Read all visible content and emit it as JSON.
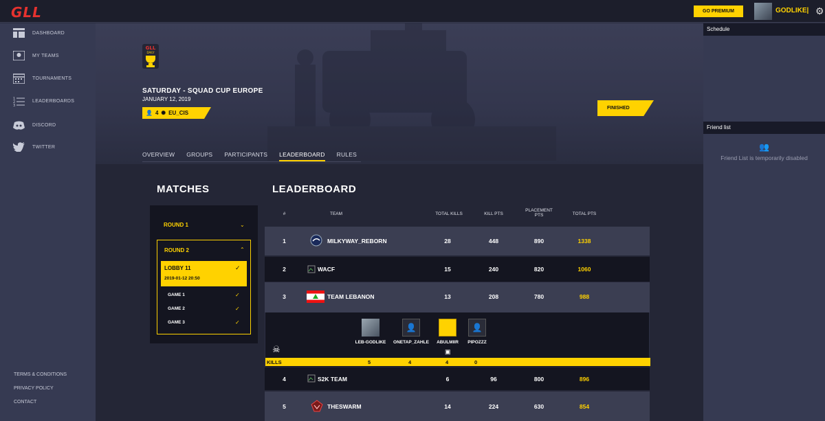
{
  "topbar": {
    "logo": "GLL",
    "premium_label": "GO PREMIUM",
    "username": "GODLIKE|"
  },
  "sidebar": {
    "items": [
      {
        "label": "DASHBOARD",
        "icon": "dashboard-icon"
      },
      {
        "label": "MY TEAMS",
        "icon": "teams-icon"
      },
      {
        "label": "TOURNAMENTS",
        "icon": "tournaments-icon"
      },
      {
        "label": "LEADERBOARDS",
        "icon": "leaderboards-icon"
      },
      {
        "label": "DISCORD",
        "icon": "discord-icon"
      },
      {
        "label": "TWITTER",
        "icon": "twitter-icon"
      }
    ],
    "footer": [
      "TERMS & CONDITIONS",
      "PRIVACY POLICY",
      "CONTACT"
    ]
  },
  "event": {
    "badge_top": "GLL",
    "badge_bottom": "DAILY",
    "title": "SATURDAY - SQUAD CUP EUROPE",
    "date": "JANUARY 12, 2019",
    "team_size": "4",
    "region": "EU_CIS",
    "status": "FINISHED"
  },
  "tabs": [
    "OVERVIEW",
    "GROUPS",
    "PARTICIPANTS",
    "LEADERBOARD",
    "RULES"
  ],
  "active_tab": "LEADERBOARD",
  "matches": {
    "heading": "MATCHES",
    "round1": "ROUND 1",
    "round2": "ROUND 2",
    "lobby_name": "LOBBY 11",
    "lobby_time": "2019-01-12 20:50",
    "games": [
      "GAME 1",
      "GAME 2",
      "GAME 3"
    ]
  },
  "leaderboard": {
    "heading": "LEADERBOARD",
    "columns": {
      "rank": "#",
      "team": "TEAM",
      "kills": "TOTAL KILLS",
      "kill_pts": "KILL PTS",
      "placement_pts_1": "PLACEMENT",
      "placement_pts_2": "PTS",
      "total_pts": "TOTAL PTS"
    },
    "rows": [
      {
        "rank": "1",
        "team": "MILKYWAY_REBORN",
        "kills": "28",
        "kill_pts": "448",
        "placement_pts": "890",
        "total_pts": "1338"
      },
      {
        "rank": "2",
        "team": "WACF",
        "kills": "15",
        "kill_pts": "240",
        "placement_pts": "820",
        "total_pts": "1060"
      },
      {
        "rank": "3",
        "team": "TEAM LEBANON",
        "kills": "13",
        "kill_pts": "208",
        "placement_pts": "780",
        "total_pts": "988"
      },
      {
        "rank": "4",
        "team": "S2K TEAM",
        "kills": "6",
        "kill_pts": "96",
        "placement_pts": "800",
        "total_pts": "896"
      },
      {
        "rank": "5",
        "team": "THESWARM",
        "kills": "14",
        "kill_pts": "224",
        "placement_pts": "630",
        "total_pts": "854"
      }
    ],
    "expanded_players": [
      {
        "name": "LEB-GODLIKE",
        "kills": "5"
      },
      {
        "name": "ONETAP_ZAHLE",
        "kills": "4"
      },
      {
        "name": "ABULMIIR",
        "kills": "4"
      },
      {
        "name": "PIPOZZZ",
        "kills": "0"
      }
    ],
    "kills_label": "KILLS"
  },
  "right": {
    "schedule": "Schedule",
    "friend_list": "Friend list",
    "friend_msg": "Friend List is temporarily disabled"
  },
  "colors": {
    "accent": "#ffd200",
    "logo_red": "#e6322f"
  }
}
